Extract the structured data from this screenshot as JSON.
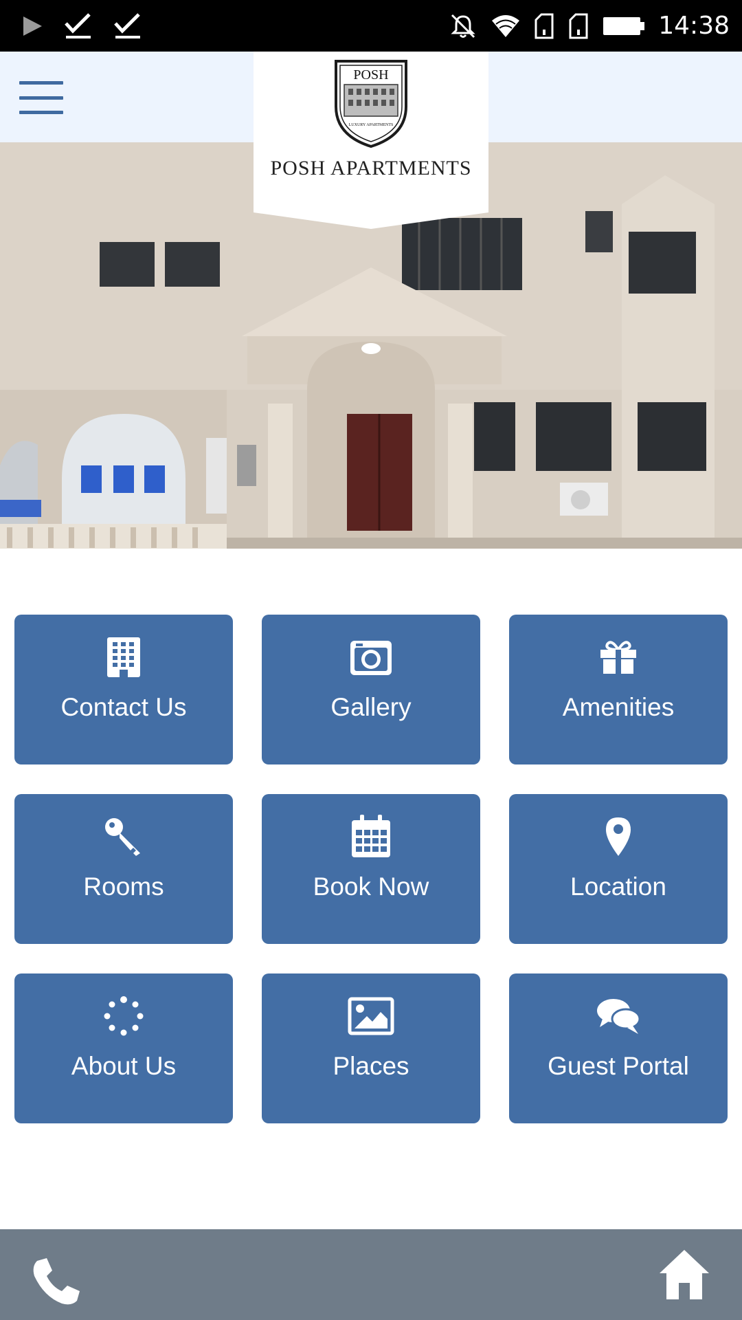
{
  "status_bar": {
    "time": "14:38",
    "icons": [
      "play-store-icon",
      "check-icon",
      "check-icon",
      "notifications-off-icon",
      "wifi-icon",
      "sim-card-icon",
      "sim-card-icon",
      "battery-icon"
    ]
  },
  "header": {
    "menu_icon": "hamburger-menu-icon",
    "logo": {
      "crest_text": "POSH",
      "crest_subtext": "LUXURY APARTMENTS",
      "name": "POSH APARTMENTS"
    }
  },
  "tiles": [
    {
      "label": "Contact Us",
      "icon": "building-icon"
    },
    {
      "label": "Gallery",
      "icon": "camera-icon"
    },
    {
      "label": "Amenities",
      "icon": "gift-icon"
    },
    {
      "label": "Rooms",
      "icon": "key-icon"
    },
    {
      "label": "Book Now",
      "icon": "calendar-icon"
    },
    {
      "label": "Location",
      "icon": "map-pin-icon"
    },
    {
      "label": "About Us",
      "icon": "spinner-icon"
    },
    {
      "label": "Places",
      "icon": "image-icon"
    },
    {
      "label": "Guest Portal",
      "icon": "chat-icon"
    }
  ],
  "bottom_bar": {
    "left_icon": "phone-icon",
    "right_icon": "home-icon"
  },
  "colors": {
    "tile": "#436ea5",
    "header_bg": "#edf4fe",
    "bottom_bar": "#6f7c89",
    "menu_icon": "#3f6aa0"
  }
}
